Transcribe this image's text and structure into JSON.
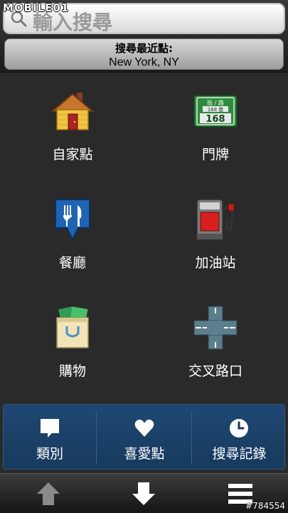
{
  "watermark": "MOBILE01",
  "search": {
    "placeholder": "輸入搜尋"
  },
  "location": {
    "label": "搜尋最近點:",
    "value": "New York, NY"
  },
  "tiles": [
    {
      "label": "自家點",
      "icon": "home-icon"
    },
    {
      "label": "門牌",
      "icon": "street-sign-icon"
    },
    {
      "label": "餐廳",
      "icon": "restaurant-icon"
    },
    {
      "label": "加油站",
      "icon": "gas-station-icon"
    },
    {
      "label": "購物",
      "icon": "shopping-bag-icon"
    },
    {
      "label": "交叉路口",
      "icon": "intersection-icon"
    }
  ],
  "street_sign": {
    "top": "街 / 路",
    "mid": "168 巷",
    "number": "168"
  },
  "categories": [
    {
      "label": "類別",
      "icon": "category-icon"
    },
    {
      "label": "喜愛點",
      "icon": "heart-icon"
    },
    {
      "label": "搜尋記錄",
      "icon": "clock-icon"
    }
  ],
  "nav": [
    "up-arrow-icon",
    "down-arrow-icon",
    "menu-icon"
  ],
  "credit": "#784554",
  "colors": {
    "category_bar": "#1f4872",
    "accent_green": "#2e8b3e"
  }
}
